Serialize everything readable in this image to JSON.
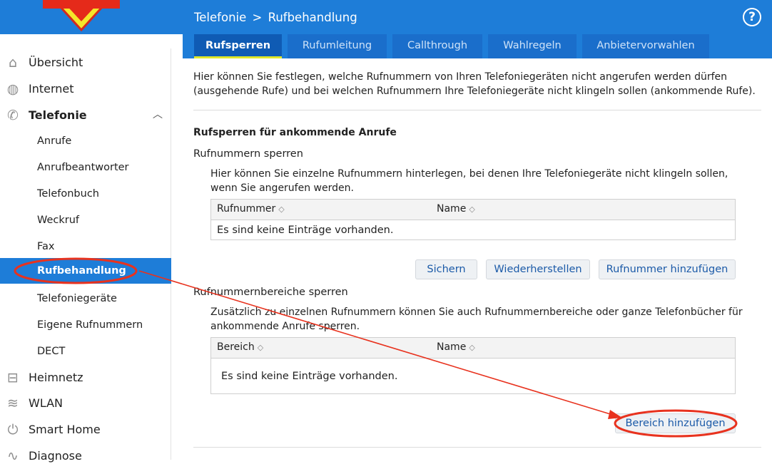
{
  "header": {
    "breadcrumb_section": "Telefonie",
    "breadcrumb_sep": ">",
    "breadcrumb_page": "Rufbehandlung",
    "help_label": "?"
  },
  "tabs": [
    {
      "label": "Rufsperren",
      "active": true
    },
    {
      "label": "Rufumleitung",
      "active": false
    },
    {
      "label": "Callthrough",
      "active": false
    },
    {
      "label": "Wahlregeln",
      "active": false
    },
    {
      "label": "Anbietervorwahlen",
      "active": false
    }
  ],
  "sidebar": {
    "items": [
      {
        "label": "Übersicht",
        "icon": "home-icon"
      },
      {
        "label": "Internet",
        "icon": "globe-icon"
      },
      {
        "label": "Telefonie",
        "icon": "phone-icon",
        "expanded": true
      },
      {
        "label": "Anrufe"
      },
      {
        "label": "Anrufbeantworter"
      },
      {
        "label": "Telefonbuch"
      },
      {
        "label": "Weckruf"
      },
      {
        "label": "Fax"
      },
      {
        "label": "Rufbehandlung",
        "selected": true
      },
      {
        "label": "Telefoniegeräte"
      },
      {
        "label": "Eigene Rufnummern"
      },
      {
        "label": "DECT"
      },
      {
        "label": "Heimnetz",
        "icon": "network-icon"
      },
      {
        "label": "WLAN",
        "icon": "wifi-icon"
      },
      {
        "label": "Smart Home",
        "icon": "power-icon"
      },
      {
        "label": "Diagnose",
        "icon": "diagnose-icon"
      }
    ]
  },
  "main": {
    "intro": "Hier können Sie festlegen, welche Rufnummern von Ihren Telefoniegeräten nicht angerufen werden dürfen (ausgehende Rufe) und bei welchen Rufnummern Ihre Telefoniegeräte nicht klingeln sollen (ankommende Rufe).",
    "incoming_heading": "Rufsperren für ankommende Anrufe",
    "numbers": {
      "heading": "Rufnummern sperren",
      "description": "Hier können Sie einzelne Rufnummern hinterlegen, bei denen Ihre Telefoniegeräte nicht klingeln sollen, wenn Sie angerufen werden.",
      "columns": [
        "Rufnummer",
        "Name"
      ],
      "empty": "Es sind keine Einträge vorhanden.",
      "buttons": {
        "save": "Sichern",
        "restore": "Wiederherstellen",
        "add": "Rufnummer hinzufügen"
      }
    },
    "ranges": {
      "heading": "Rufnummernbereiche sperren",
      "description": "Zusätzlich zu einzelnen Rufnummern können Sie auch Rufnummernbereiche oder ganze Telefonbücher für ankommende Anrufe sperren.",
      "columns": [
        "Bereich",
        "Name"
      ],
      "empty": "Es sind keine Einträge vorhanden.",
      "buttons": {
        "add": "Bereich hinzufügen"
      }
    }
  },
  "colors": {
    "brand_blue": "#1e7dd8",
    "tab_active": "#0f5bb4",
    "tab_underline": "#dfe82a",
    "annotation_red": "#e8321e"
  }
}
